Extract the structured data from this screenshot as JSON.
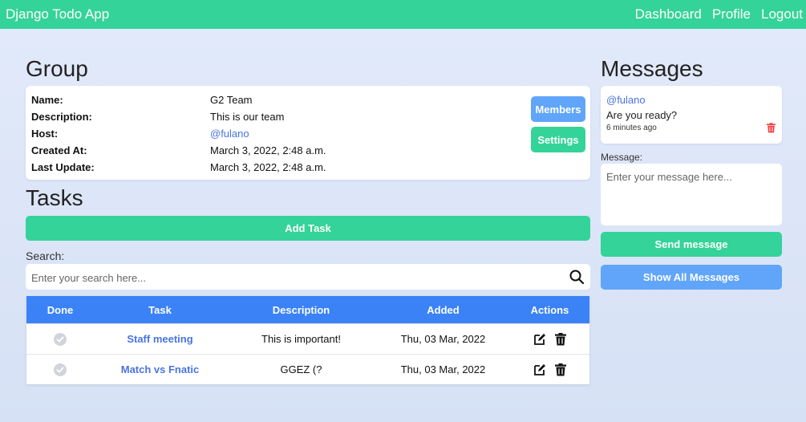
{
  "nav": {
    "brand": "Django Todo App",
    "links": [
      "Dashboard",
      "Profile",
      "Logout"
    ]
  },
  "group": {
    "heading": "Group",
    "fields": [
      {
        "label": "Name:",
        "value": "G2 Team"
      },
      {
        "label": "Description:",
        "value": "This is our team"
      },
      {
        "label": "Host:",
        "value": "@fulano"
      },
      {
        "label": "Created At:",
        "value": "March 3, 2022, 2:48 a.m."
      },
      {
        "label": "Last Update:",
        "value": "March 3, 2022, 2:48 a.m."
      }
    ],
    "members_button": "Members",
    "settings_button": "Settings"
  },
  "tasks": {
    "heading": "Tasks",
    "add_button": "Add Task",
    "search_label": "Search:",
    "search_placeholder": "Enter your search here...",
    "columns": [
      "Done",
      "Task",
      "Description",
      "Added",
      "Actions"
    ],
    "rows": [
      {
        "task": "Staff meeting",
        "description": "This is important!",
        "added": "Thu, 03 Mar, 2022"
      },
      {
        "task": "Match vs Fnatic",
        "description": "GGEZ (?",
        "added": "Thu, 03 Mar, 2022"
      }
    ]
  },
  "messages": {
    "heading": "Messages",
    "items": [
      {
        "user": "@fulano",
        "text": "Are you ready?",
        "time": "6 minutes ago"
      }
    ],
    "message_label": "Message:",
    "message_placeholder": "Enter your message here...",
    "send_button": "Send message",
    "show_all_button": "Show All Messages"
  },
  "colors": {
    "navbar": "#34d399",
    "primary_blue": "#3b82f6",
    "light_blue": "#60a5fa",
    "link": "#4a74e0",
    "delete_red": "#ef4444"
  }
}
